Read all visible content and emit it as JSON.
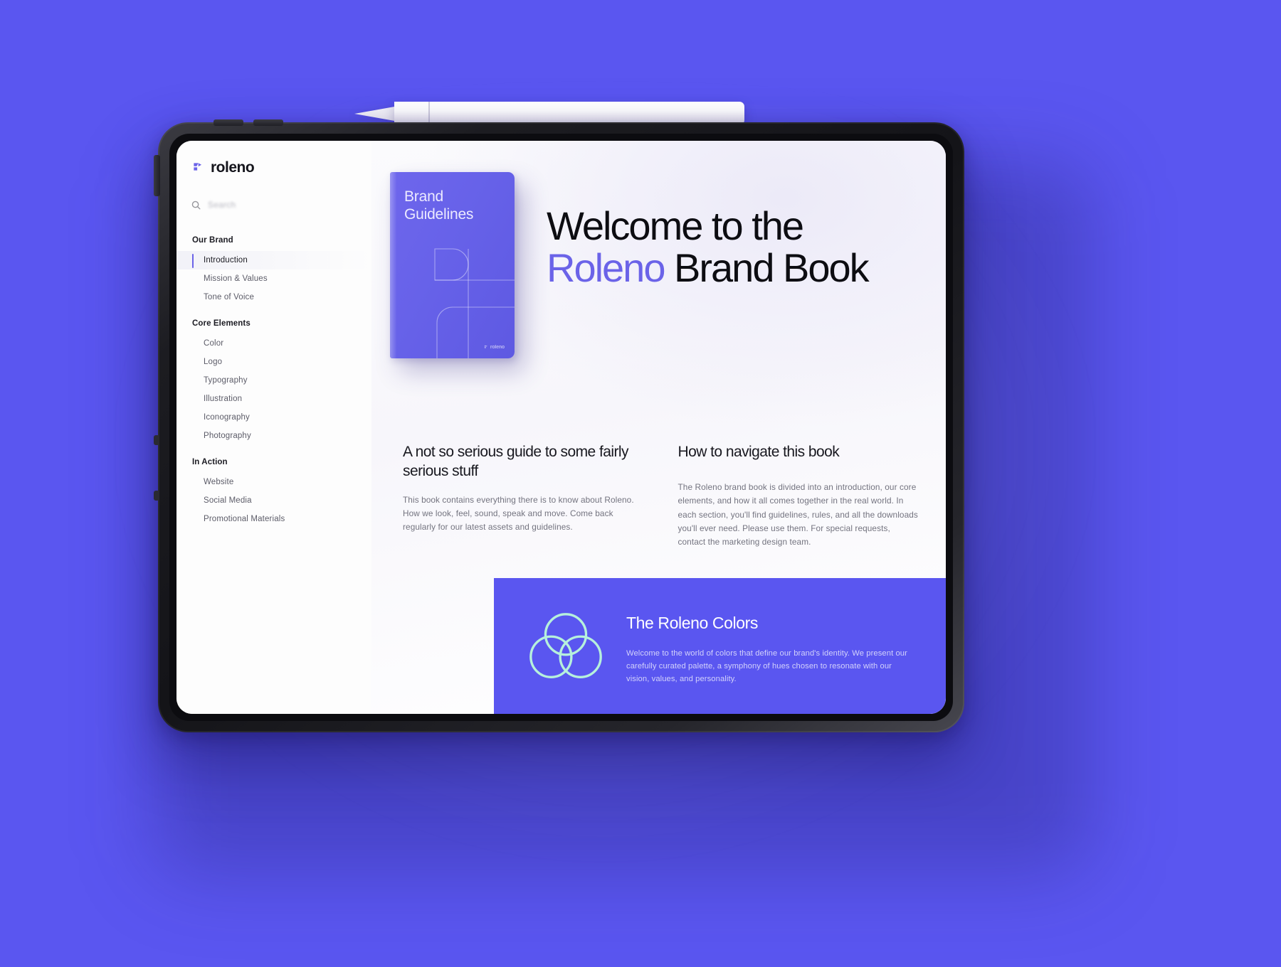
{
  "page": {
    "background_color": "#5A56F0",
    "accent_color": "#6B63E8"
  },
  "device": {
    "type": "tablet-mockup",
    "stylus": "white-stylus"
  },
  "sidebar": {
    "logo": {
      "mark": "roleno-logo-mark",
      "wordmark": "roleno"
    },
    "search": {
      "icon": "search-icon",
      "placeholder": "Search",
      "value": ""
    },
    "groups": [
      {
        "title": "Our Brand",
        "items": [
          {
            "label": "Introduction",
            "active": true
          },
          {
            "label": "Mission & Values",
            "active": false
          },
          {
            "label": "Tone of Voice",
            "active": false
          }
        ]
      },
      {
        "title": "Core Elements",
        "items": [
          {
            "label": "Color",
            "active": false
          },
          {
            "label": "Logo",
            "active": false
          },
          {
            "label": "Typography",
            "active": false
          },
          {
            "label": "Illustration",
            "active": false
          },
          {
            "label": "Iconography",
            "active": false
          },
          {
            "label": "Photography",
            "active": false
          }
        ]
      },
      {
        "title": "In Action",
        "items": [
          {
            "label": "Website",
            "active": false
          },
          {
            "label": "Social Media",
            "active": false
          },
          {
            "label": "Promotional Materials",
            "active": false
          }
        ]
      }
    ]
  },
  "hero": {
    "book": {
      "title_line1": "Brand",
      "title_line2": "Guidelines",
      "logo_word": "roleno",
      "cover_color": "#6762E9"
    },
    "heading": {
      "line1": "Welcome to the",
      "accent_word": "Roleno",
      "line2_rest": " Brand Book"
    }
  },
  "content": {
    "left_column": {
      "heading": "A not so serious guide to some fairly serious stuff",
      "body": "This book contains everything there is to know about Roleno. How we look, feel, sound, speak and move. Come back regularly for our latest assets and guidelines."
    },
    "right_column": {
      "heading": "How to navigate this book",
      "body": "The Roleno brand book is divided into an introduction, our core elements, and how it all comes together in the real world. In each section, you'll find guidelines, rules, and all the downloads you'll ever need. Please use them. For special requests, contact the marketing design team."
    }
  },
  "colors_section": {
    "icon": "venn-circles-icon",
    "icon_color": "#B6F0DC",
    "background_color": "#5A56F0",
    "heading": "The Roleno Colors",
    "body": "Welcome to the world of colors that define our brand's identity. We present our carefully curated palette, a symphony of hues chosen to resonate with our vision, values, and personality."
  }
}
